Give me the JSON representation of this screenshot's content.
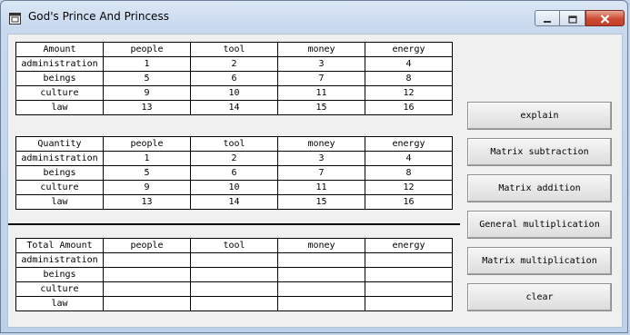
{
  "window": {
    "title": "God's Prince And Princess"
  },
  "tables": [
    {
      "header": [
        "Amount",
        "people",
        "tool",
        "money",
        "energy"
      ],
      "rows": [
        [
          "administration",
          "1",
          "2",
          "3",
          "4"
        ],
        [
          "beings",
          "5",
          "6",
          "7",
          "8"
        ],
        [
          "culture",
          "9",
          "10",
          "11",
          "12"
        ],
        [
          "law",
          "13",
          "14",
          "15",
          "16"
        ]
      ]
    },
    {
      "header": [
        "Quantity",
        "people",
        "tool",
        "money",
        "energy"
      ],
      "rows": [
        [
          "administration",
          "1",
          "2",
          "3",
          "4"
        ],
        [
          "beings",
          "5",
          "6",
          "7",
          "8"
        ],
        [
          "culture",
          "9",
          "10",
          "11",
          "12"
        ],
        [
          "law",
          "13",
          "14",
          "15",
          "16"
        ]
      ]
    },
    {
      "header": [
        "Total Amount",
        "people",
        "tool",
        "money",
        "energy"
      ],
      "rows": [
        [
          "administration",
          "",
          "",
          "",
          ""
        ],
        [
          "beings",
          "",
          "",
          "",
          ""
        ],
        [
          "culture",
          "",
          "",
          "",
          ""
        ],
        [
          "law",
          "",
          "",
          "",
          ""
        ]
      ]
    }
  ],
  "buttons": {
    "explain": "explain",
    "subtraction": "Matrix subtraction",
    "addition": "Matrix addition",
    "general_multiplication": "General multiplication",
    "matrix_multiplication": "Matrix multiplication",
    "clear": "clear"
  },
  "colors": {
    "titlebar": "#c8d9ee",
    "close_button": "#c7442c",
    "client": "#f0f0f0"
  }
}
